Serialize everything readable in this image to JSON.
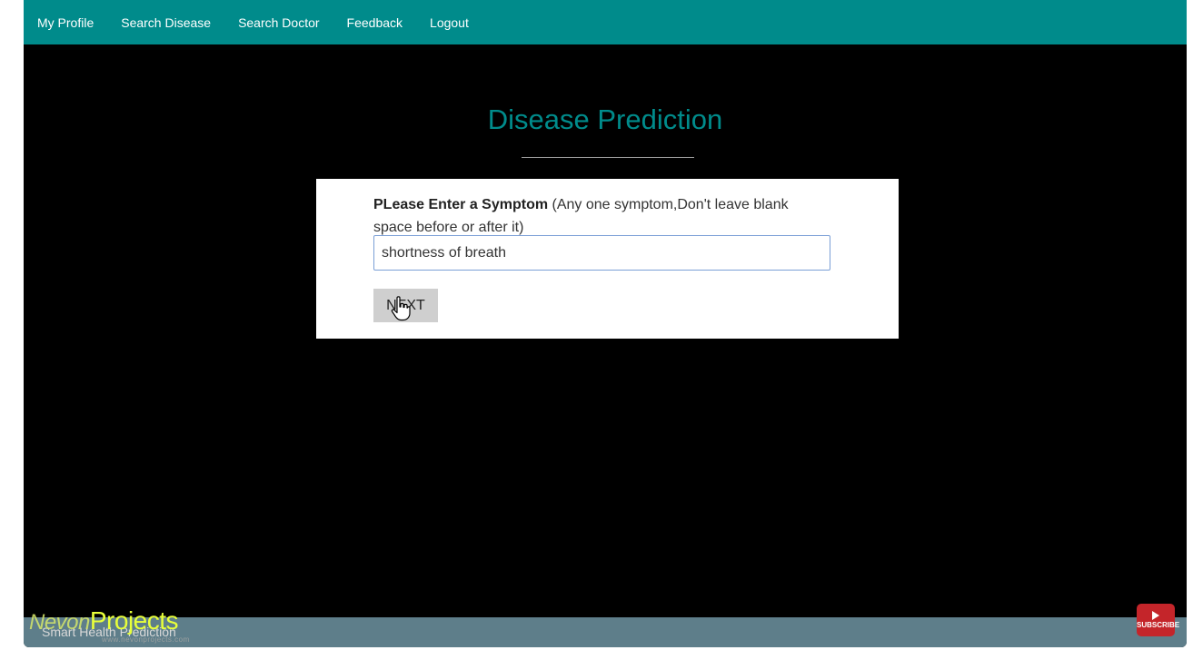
{
  "nav": {
    "items": [
      {
        "label": "My Profile"
      },
      {
        "label": "Search Disease"
      },
      {
        "label": "Search Doctor"
      },
      {
        "label": "Feedback"
      },
      {
        "label": "Logout"
      }
    ]
  },
  "main": {
    "title": "Disease Prediction",
    "prompt_bold": "PLease Enter a Symptom",
    "prompt_rest": " (Any one symptom,Don't leave blank space before or after it)",
    "symptom_value": "shortness of breath",
    "next_label": "NEXT"
  },
  "footer": {
    "text": "Smart Health Prediction",
    "watermark": "Projects",
    "watermark_prefix": "Nevon",
    "watermark_sub": "www.nevonprojects.com",
    "subscribe_label": "SUBSCRIBE"
  },
  "colors": {
    "nav_bg": "#008b8b",
    "title": "#008b8b",
    "page_bg": "#000000",
    "footer_bg": "#5e7e8a",
    "watermark": "#e8ff3a",
    "subscribe_bg": "#c4252a"
  }
}
